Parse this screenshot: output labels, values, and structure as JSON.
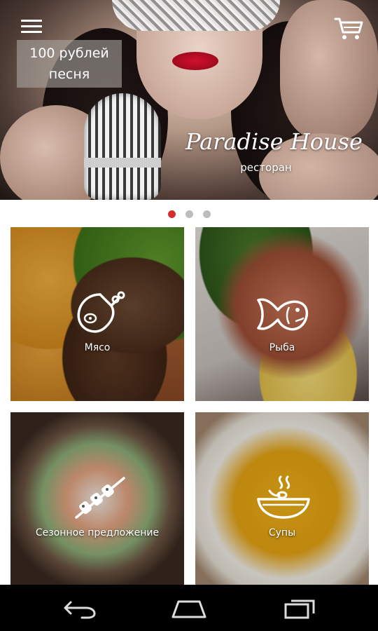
{
  "header": {
    "promo_line1": "100 рублей",
    "promo_line2": "песня",
    "brand_name": "Paradise House",
    "brand_subtitle": "ресторан"
  },
  "carousel": {
    "total": 3,
    "active": 1
  },
  "categories": [
    {
      "label": "Мясо",
      "icon": "meat-drumstick-icon"
    },
    {
      "label": "Рыба",
      "icon": "fish-icon"
    },
    {
      "label": "Сезонное предложение",
      "icon": "kebab-skewer-icon"
    },
    {
      "label": "Супы",
      "icon": "soup-bowl-icon"
    }
  ],
  "colors": {
    "accent": "#d32f2f",
    "dot_inactive": "#bdbdbd",
    "navbar": "#000000"
  },
  "navbar": {
    "icons": [
      "back-icon",
      "home-icon",
      "recent-apps-icon"
    ]
  }
}
